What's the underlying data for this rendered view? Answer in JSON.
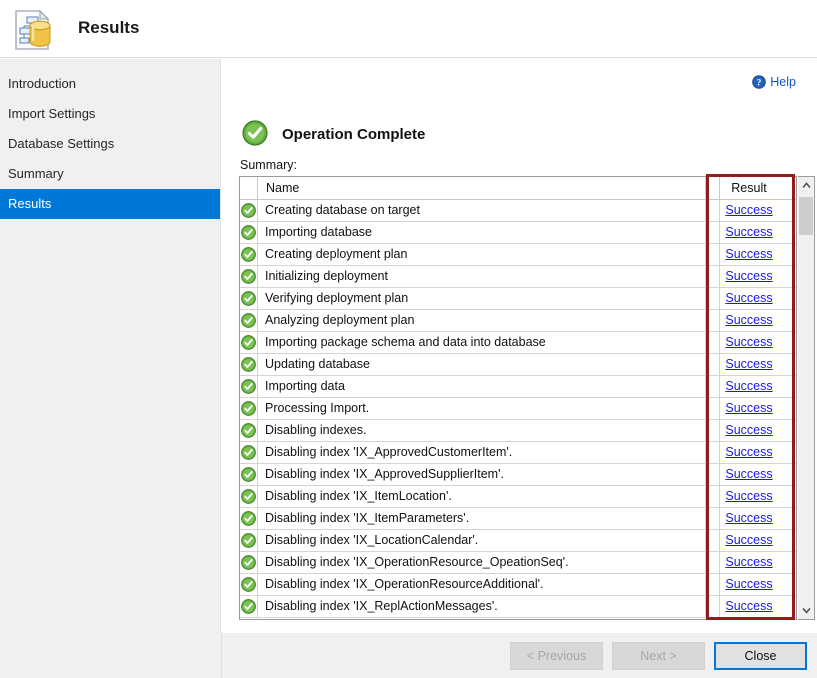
{
  "header": {
    "title": "Results",
    "icon": "database-document-icon"
  },
  "sidebar": {
    "items": [
      {
        "label": "Introduction",
        "selected": false
      },
      {
        "label": "Import Settings",
        "selected": false
      },
      {
        "label": "Database Settings",
        "selected": false
      },
      {
        "label": "Summary",
        "selected": false
      },
      {
        "label": "Results",
        "selected": true
      }
    ]
  },
  "content": {
    "help_label": "Help",
    "help_icon": "help-circle-icon",
    "status_icon": "success-check-icon",
    "status_title": "Operation Complete",
    "summary_label": "Summary:",
    "columns": {
      "icon": "",
      "name": "Name",
      "result": "Result"
    },
    "rows": [
      {
        "icon": "success-check-icon",
        "name": "Creating database on target",
        "result": "Success"
      },
      {
        "icon": "success-check-icon",
        "name": "Importing database",
        "result": "Success"
      },
      {
        "icon": "success-check-icon",
        "name": "Creating deployment plan",
        "result": "Success"
      },
      {
        "icon": "success-check-icon",
        "name": "Initializing deployment",
        "result": "Success"
      },
      {
        "icon": "success-check-icon",
        "name": "Verifying deployment plan",
        "result": "Success"
      },
      {
        "icon": "success-check-icon",
        "name": "Analyzing deployment plan",
        "result": "Success"
      },
      {
        "icon": "success-check-icon",
        "name": "Importing package schema and data into database",
        "result": "Success"
      },
      {
        "icon": "success-check-icon",
        "name": "Updating database",
        "result": "Success"
      },
      {
        "icon": "success-check-icon",
        "name": "Importing data",
        "result": "Success"
      },
      {
        "icon": "success-check-icon",
        "name": "Processing Import.",
        "result": "Success"
      },
      {
        "icon": "success-check-icon",
        "name": "Disabling indexes.",
        "result": "Success"
      },
      {
        "icon": "success-check-icon",
        "name": "Disabling index 'IX_ApprovedCustomerItem'.",
        "result": "Success"
      },
      {
        "icon": "success-check-icon",
        "name": "Disabling index 'IX_ApprovedSupplierItem'.",
        "result": "Success"
      },
      {
        "icon": "success-check-icon",
        "name": "Disabling index 'IX_ItemLocation'.",
        "result": "Success"
      },
      {
        "icon": "success-check-icon",
        "name": "Disabling index 'IX_ItemParameters'.",
        "result": "Success"
      },
      {
        "icon": "success-check-icon",
        "name": "Disabling index 'IX_LocationCalendar'.",
        "result": "Success"
      },
      {
        "icon": "success-check-icon",
        "name": "Disabling index 'IX_OperationResource_OpeationSeq'.",
        "result": "Success"
      },
      {
        "icon": "success-check-icon",
        "name": "Disabling index 'IX_OperationResourceAdditional'.",
        "result": "Success"
      },
      {
        "icon": "success-check-icon",
        "name": "Disabling index 'IX_ReplActionMessages'.",
        "result": "Success"
      }
    ]
  },
  "scrollbar": {
    "up_icon": "chevron-up-icon",
    "down_icon": "chevron-down-icon"
  },
  "annotation": {
    "color": "#8f1d1d",
    "target": "result-column"
  },
  "footer": {
    "previous_label": "< Previous",
    "next_label": "Next >",
    "close_label": "Close"
  }
}
